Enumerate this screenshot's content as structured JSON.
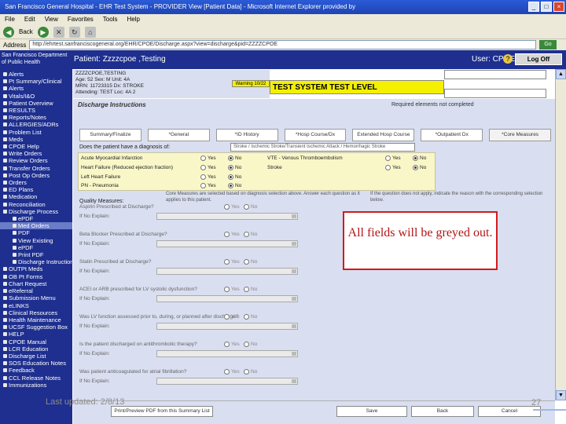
{
  "window": {
    "title": "San Francisco General Hospital - EHR Test System - PROVIDER View [Patient Data] - Microsoft Internet Explorer provided by",
    "menu": [
      "File",
      "Edit",
      "View",
      "Favorites",
      "Tools",
      "Help"
    ],
    "back_label": "Back",
    "address_label": "Address",
    "address": "http://ehrtest.sanfranciscogeneral.org/EHR/CPOE/Discharge.aspx?view=discharge&pid=ZZZZCPOE",
    "go_label": "Go"
  },
  "header": {
    "logo": "San Francisco Department of Public Health",
    "patient": "Patient: Zzzzcpoe ,Testing",
    "user": "User: CPOE1",
    "logoff": "Log Off"
  },
  "sidebar": {
    "items": [
      {
        "label": "Alerts",
        "sub": false,
        "sel": false
      },
      {
        "label": "Pt Summary/Clinical",
        "sub": false,
        "sel": false
      },
      {
        "label": "Alerts",
        "sub": false,
        "sel": false
      },
      {
        "label": "Vitals/I&O",
        "sub": false,
        "sel": false
      },
      {
        "label": "Patient Overview",
        "sub": false,
        "sel": false
      },
      {
        "label": "RESULTS",
        "sub": false,
        "sel": false
      },
      {
        "label": "Reports/Notes",
        "sub": false,
        "sel": false
      },
      {
        "label": "ALLERGIES/ADRs",
        "sub": false,
        "sel": false
      },
      {
        "label": "Problem List",
        "sub": false,
        "sel": false
      },
      {
        "label": "Meds",
        "sub": false,
        "sel": false
      },
      {
        "label": "CPOE Help",
        "sub": false,
        "sel": false
      },
      {
        "label": "Write Orders",
        "sub": false,
        "sel": false
      },
      {
        "label": "Review Orders",
        "sub": false,
        "sel": false
      },
      {
        "label": "Transfer Orders",
        "sub": false,
        "sel": false
      },
      {
        "label": "Post Op Orders",
        "sub": false,
        "sel": false
      },
      {
        "label": "Orders",
        "sub": false,
        "sel": false
      },
      {
        "label": "ED Plans",
        "sub": false,
        "sel": false
      },
      {
        "label": "Medication",
        "sub": false,
        "sel": false
      },
      {
        "label": "Reconciliation",
        "sub": false,
        "sel": false
      },
      {
        "label": "Discharge Process",
        "sub": false,
        "sel": false
      },
      {
        "label": "ePDF",
        "sub": true,
        "sel": false
      },
      {
        "label": "Med Orders",
        "sub": true,
        "sel": true
      },
      {
        "label": "PDF",
        "sub": true,
        "sel": false
      },
      {
        "label": "View Existing",
        "sub": true,
        "sel": false
      },
      {
        "label": "ePDF",
        "sub": true,
        "sel": false
      },
      {
        "label": "Print PDF",
        "sub": true,
        "sel": false
      },
      {
        "label": "Discharge Instructions",
        "sub": true,
        "sel": false
      },
      {
        "label": "OUTPt Meds",
        "sub": false,
        "sel": false
      },
      {
        "label": "OB Pt Forms",
        "sub": false,
        "sel": false
      },
      {
        "label": "Chart Request",
        "sub": false,
        "sel": false
      },
      {
        "label": "eReferral",
        "sub": false,
        "sel": false
      },
      {
        "label": "Submission Menu",
        "sub": false,
        "sel": false
      },
      {
        "label": "eLINKS",
        "sub": false,
        "sel": false
      },
      {
        "label": "Clinical Resources",
        "sub": false,
        "sel": false
      },
      {
        "label": "Health Maintenance",
        "sub": false,
        "sel": false
      },
      {
        "label": "UCSF Suggestion Box",
        "sub": false,
        "sel": false
      },
      {
        "label": "HELP",
        "sub": false,
        "sel": false
      },
      {
        "label": "CPOE Manual",
        "sub": false,
        "sel": false
      },
      {
        "label": "LCR Education",
        "sub": false,
        "sel": false
      },
      {
        "label": "Discharge List",
        "sub": false,
        "sel": false
      },
      {
        "label": "SOS Education Notes",
        "sub": false,
        "sel": false
      },
      {
        "label": "Feedback",
        "sub": false,
        "sel": false
      },
      {
        "label": "CCL Release Notes",
        "sub": false,
        "sel": false
      },
      {
        "label": "Immunizations",
        "sub": false,
        "sel": false
      }
    ]
  },
  "demographics": {
    "line1": "ZZZZCPOE,TESTING",
    "line2": "Age: 52   Sex: M   Unit: 4A",
    "line3": "MRN: 11723315   Dx: STROKE",
    "line4": "Attending: TEST   Loc: 4A 2"
  },
  "banner": {
    "warning": "Warning 10/22",
    "test_level": "TEST SYSTEM TEST LEVEL"
  },
  "form": {
    "heading": "Discharge Instructions",
    "required_note": "Required elements not completed",
    "tabs": [
      "Summary/Finalize",
      "*General",
      "*ID History",
      "*Hosp Course/Dx",
      "Extended Hosp Course",
      "*Outpatient Dx",
      "*Core Measures"
    ],
    "dx_question": "Does the patient have a diagnosis of:",
    "dx_select": "Stroke / Ischemic Stroke/Transient Ischemic Attack / Hemorrhagic Stroke",
    "dx_rows": [
      {
        "label": "Acute Myocardial Infarction",
        "yes": "Yes",
        "no": "No",
        "label2": "VTE - Venous Thromboembolism",
        "yes2": "Yes",
        "no2": "No"
      },
      {
        "label": "Heart Failure (Reduced ejection fraction)",
        "yes": "Yes",
        "no": "No",
        "label2": "Stroke",
        "yes2": "Yes",
        "no2": "No"
      },
      {
        "label": "Left Heart Failure",
        "yes": "Yes",
        "no": "No"
      },
      {
        "label": "PN - Pneumonia",
        "yes": "Yes",
        "no": "No"
      }
    ],
    "quality_label": "Quality Measures:",
    "quality_text": "Core Measures are selected based on diagnosis selection above. Answer each question as it applies to this patient.",
    "quality_text2": "If the question does not apply, indicate the reason with the corresponding selection below.",
    "measures": [
      {
        "q": "Aspirin Prescribed at Discharge?",
        "yes": "Yes",
        "no": "No",
        "sub": "If No Explain:"
      },
      {
        "q": "Beta Blocker Prescribed at Discharge?",
        "yes": "Yes",
        "no": "No",
        "sub": "If No Explain:"
      },
      {
        "q": "Statin Prescribed at Discharge?",
        "yes": "Yes",
        "no": "No",
        "sub": "If No Explain:"
      },
      {
        "q": "ACEI or ARB prescribed for LV systolic dysfunction?",
        "yes": "Yes",
        "no": "No",
        "sub": "If No Explain:"
      },
      {
        "q": "Was LV function assessed prior to, during, or planned after discharge?",
        "yes": "Yes",
        "no": "No",
        "sub": "If No Explain:"
      },
      {
        "q": "Is the patient discharged on antithrombotic therapy?",
        "yes": "Yes",
        "no": "No",
        "sub": "If No Explain:"
      },
      {
        "q": "Was patient anticoagulated for atrial fibrillation?",
        "yes": "Yes",
        "no": "No",
        "sub": "If No Explain:"
      }
    ],
    "buttons": {
      "print": "Print/Preview PDF from this Summary List",
      "save": "Save",
      "back": "Back",
      "cancel": "Cancel"
    }
  },
  "callout": "All fields will be greyed out.",
  "slide": {
    "last_updated": "Last updated: 2/8/13",
    "page": "27"
  }
}
